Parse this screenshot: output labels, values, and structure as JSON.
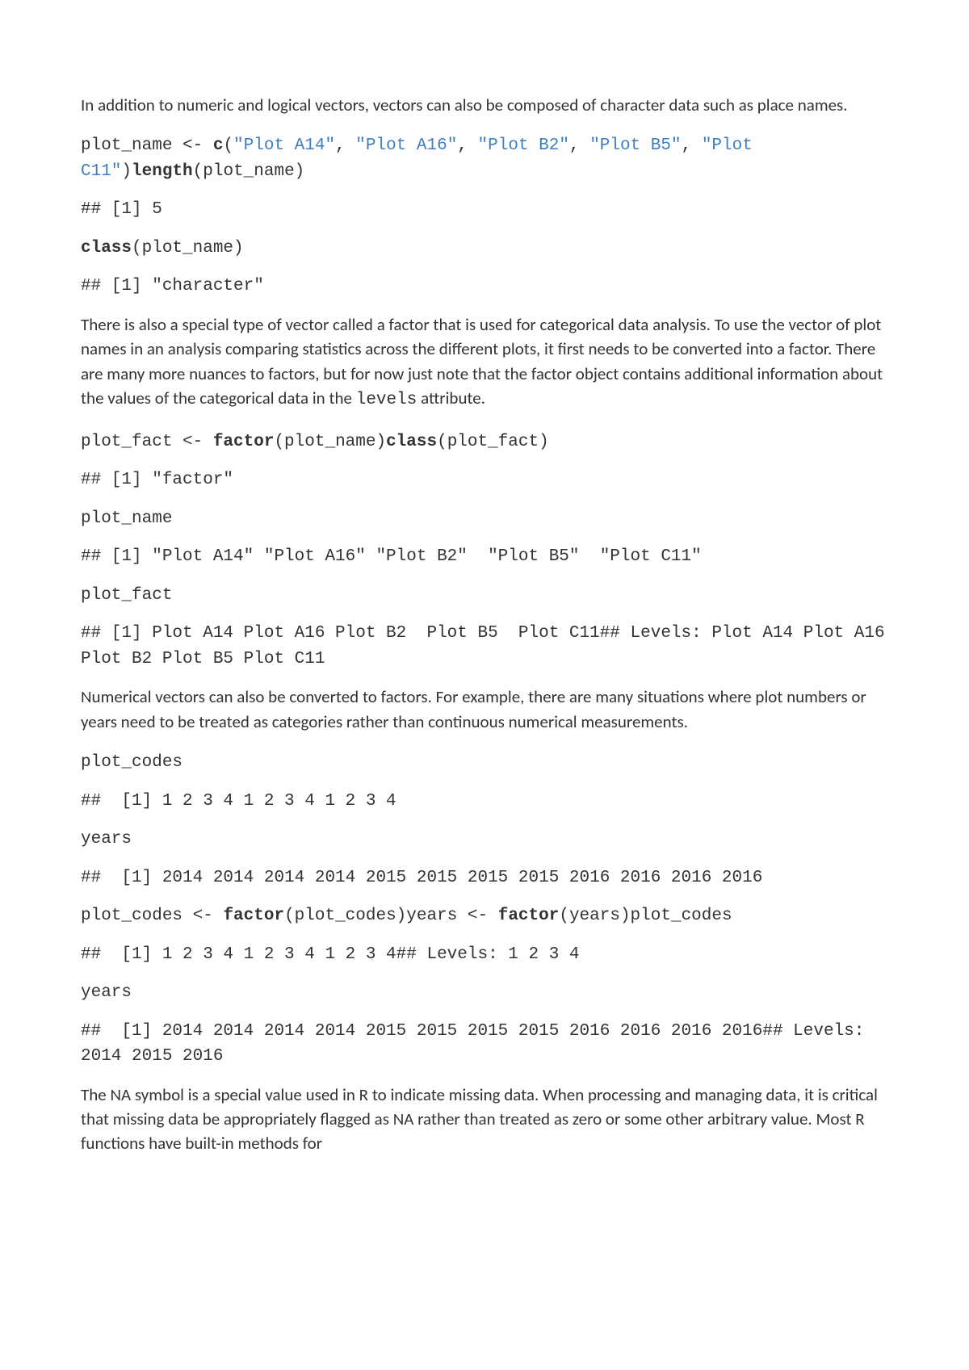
{
  "para1": "In addition to numeric and logical vectors, vectors can also be composed of character data such as place names.",
  "code1": {
    "a": "plot_name <- ",
    "b": "c",
    "c": "(",
    "d": "\"Plot A14\"",
    "e": ", ",
    "f": "\"Plot A16\"",
    "g": ", ",
    "h": "\"Plot B2\"",
    "i": ", ",
    "j": "\"Plot B5\"",
    "k": ", ",
    "l": "\"Plot C11\"",
    "m": ")",
    "n": "length",
    "o": "(plot_name)"
  },
  "out1": "## [1] 5",
  "code2": {
    "a": "class",
    "b": "(plot_name)"
  },
  "out2": "## [1] \"character\"",
  "para2a": "There is also a special type of vector called a factor that is used for categorical data analysis. To use the vector of plot names in an analysis comparing statistics across the different plots, it first needs to be converted into a factor. There are many more nuances to factors, but for now just note that the factor object contains additional information about the values of the categorical data in the ",
  "para2b": "levels",
  "para2c": " attribute.",
  "code3": {
    "a": "plot_fact <- ",
    "b": "factor",
    "c": "(plot_name)",
    "d": "class",
    "e": "(plot_fact)"
  },
  "out3": "## [1] \"factor\"",
  "code4": "plot_name",
  "out4": "## [1] \"Plot A14\" \"Plot A16\" \"Plot B2\"  \"Plot B5\"  \"Plot C11\"",
  "code5": "plot_fact",
  "out5": "## [1] Plot A14 Plot A16 Plot B2  Plot B5  Plot C11## Levels: Plot A14 Plot A16 Plot B2 Plot B5 Plot C11",
  "para3": "Numerical vectors can also be converted to factors. For example, there are many situations where plot numbers or years need to be treated as categories rather than continuous numerical measurements.",
  "code6": "plot_codes",
  "out6": "##  [1] 1 2 3 4 1 2 3 4 1 2 3 4",
  "code7": "years",
  "out7": "##  [1] 2014 2014 2014 2014 2015 2015 2015 2015 2016 2016 2016 2016",
  "code8": {
    "a": "plot_codes <- ",
    "b": "factor",
    "c": "(plot_codes)years <- ",
    "d": "factor",
    "e": "(years)plot_codes"
  },
  "out8": "##  [1] 1 2 3 4 1 2 3 4 1 2 3 4## Levels: 1 2 3 4",
  "code9": "years",
  "out9": "##  [1] 2014 2014 2014 2014 2015 2015 2015 2015 2016 2016 2016 2016## Levels: 2014 2015 2016",
  "para4": "The NA symbol is a special value used in R to indicate missing data. When processing and managing data, it is critical that missing data be appropriately flagged as NA rather than treated as zero or some other arbitrary value. Most R functions have built-in methods for"
}
